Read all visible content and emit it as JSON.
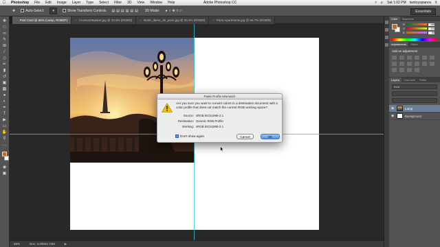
{
  "menubar": {
    "app": "Photoshop",
    "items": [
      "File",
      "Edit",
      "Image",
      "Layer",
      "Type",
      "Select",
      "Filter",
      "3D",
      "View",
      "Window",
      "Help"
    ],
    "window_title": "Adobe Photoshop CC",
    "clock": "Sat 1:02 PM",
    "user": "twotoyspianos"
  },
  "options": {
    "auto_select_label": "Auto-Select:",
    "transform_label": "Show Transform Controls",
    "mode_label": "3D Mode:",
    "workspace": "Essentials"
  },
  "tabs": [
    {
      "label": "Post Card @ 66% (Lamp, RGB/8*)",
      "active": true
    },
    {
      "label": "CroissantBasket.jpg @ 33.3% (RGB/8)",
      "active": false
    },
    {
      "label": "Notre_dame_de_paris.jpg @ 33.3% (RGB/8)",
      "active": false
    },
    {
      "label": "Paris Apartments.jpg @ 66.7% (RGB/8)",
      "active": false
    }
  ],
  "status": {
    "zoom": "66%",
    "doc": "Doc: 3.00M/4.73M"
  },
  "panels": {
    "color_tabs": [
      "Color",
      "Swatches"
    ],
    "rgb": [
      {
        "letter": "R",
        "value": "188"
      },
      {
        "letter": "G",
        "value": "111"
      },
      {
        "letter": "B",
        "value": "55"
      }
    ],
    "adjust_tabs": [
      "Adjustments",
      "Styles"
    ],
    "adjust_title": "Add an adjustment",
    "layers_tabs": [
      "Layers",
      "Channels",
      "Paths"
    ],
    "layer_filter": "Kind",
    "layers": [
      {
        "name": "Lamp",
        "selected": true
      },
      {
        "name": "Background",
        "selected": false
      }
    ]
  },
  "dialog": {
    "title": "Paste Profile Mismatch",
    "question": "Are you sure you want to convert colors to a destination document with a color profile that does not match the current RGB working space?",
    "source_label": "Source:",
    "source_value": "sRGB IEC61966-2.1",
    "destination_label": "Destination:",
    "destination_value": "Generic RGB Profile",
    "working_label": "Working:",
    "working_value": "sRGB IEC61966-2.1",
    "checkbox_label": "Don't show again",
    "checkbox_checked": true,
    "cancel_label": "Cancel",
    "ok_label": "OK"
  }
}
